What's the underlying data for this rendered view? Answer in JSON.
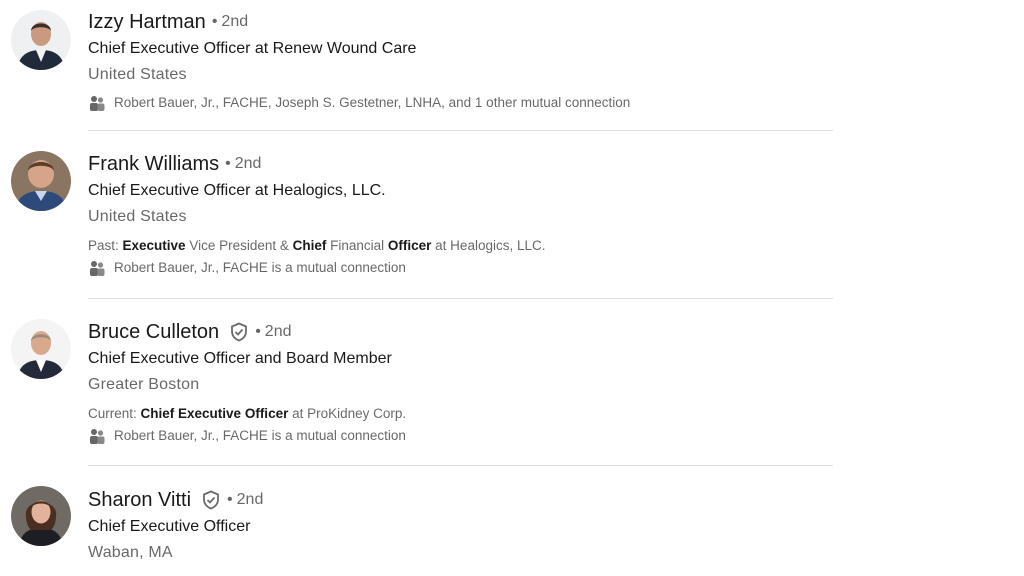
{
  "results": [
    {
      "name": "Izzy Hartman",
      "verified": false,
      "degree": "2nd",
      "headline": "Chief Executive Officer at Renew Wound Care",
      "location": "United States",
      "mutual": "Robert Bauer, Jr., FACHE, Joseph S. Gestetner, LNHA, and 1 other mutual connection",
      "avatar_icon": "person-photo",
      "avatar_colors": {
        "bg": "#eef0f2",
        "hair": "#3b2f2a",
        "skin": "#c99a7f",
        "suit": "#1f2a3a",
        "shirt": "#f2f2f2"
      }
    },
    {
      "name": "Frank Williams",
      "verified": false,
      "degree": "2nd",
      "headline": "Chief Executive Officer at Healogics, LLC.",
      "location": "United States",
      "summary": {
        "prefix": "Past: ",
        "parts": [
          {
            "text": "Executive",
            "bold": true
          },
          {
            "text": " Vice President & ",
            "bold": false
          },
          {
            "text": "Chief",
            "bold": true
          },
          {
            "text": " Financial ",
            "bold": false
          },
          {
            "text": "Officer",
            "bold": true
          },
          {
            "text": " at Healogics, LLC.",
            "bold": false
          }
        ]
      },
      "mutual": "Robert Bauer, Jr., FACHE is a mutual connection",
      "avatar_icon": "person-photo",
      "avatar_colors": {
        "bg": "#8a7462",
        "hair": "#5a3e2b",
        "skin": "#d6a489",
        "suit": "#2d4a7a",
        "shirt": "#c8d6ea"
      }
    },
    {
      "name": "Bruce Culleton",
      "verified": true,
      "degree": "2nd",
      "headline": "Chief Executive Officer and Board Member",
      "location": "Greater Boston",
      "summary": {
        "prefix": "Current: ",
        "parts": [
          {
            "text": "Chief Executive Officer",
            "bold": true
          },
          {
            "text": " at ProKidney Corp.",
            "bold": false
          }
        ]
      },
      "mutual": "Robert Bauer, Jr., FACHE is a mutual connection",
      "avatar_icon": "person-photo",
      "avatar_colors": {
        "bg": "#f4f4f4",
        "hair": "#9b8a7c",
        "skin": "#d9a98e",
        "suit": "#232b3a",
        "shirt": "#ffffff"
      }
    },
    {
      "name": "Sharon Vitti",
      "verified": true,
      "degree": "2nd",
      "headline": "Chief Executive Officer",
      "location": "Waban, MA",
      "avatar_icon": "person-photo",
      "avatar_colors": {
        "bg": "#6f6a63",
        "hair": "#4a2e22",
        "skin": "#e0b39a",
        "suit": "#1d1d24",
        "shirt": "#3a2b2b"
      }
    }
  ],
  "degree_separator": "•",
  "icons": {
    "verified": "shield-check-icon",
    "mutual": "people-icon"
  },
  "colors": {
    "primary_text": "rgba(0,0,0,0.9)",
    "secondary_text": "rgba(0,0,0,0.6)",
    "divider": "#e0dfdc"
  }
}
